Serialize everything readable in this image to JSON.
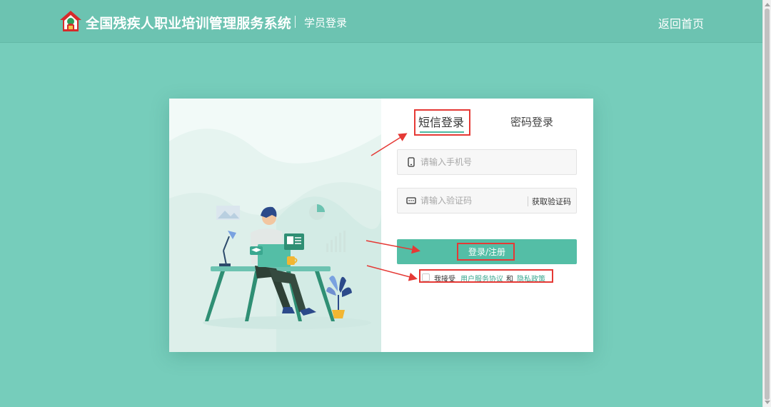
{
  "header": {
    "app_title": "全国残疾人职业培训管理服务系统",
    "page_subtitle": "学员登录",
    "home_link": "返回首页"
  },
  "login": {
    "tabs": [
      {
        "label": "短信登录",
        "active": true
      },
      {
        "label": "密码登录",
        "active": false
      }
    ],
    "phone_placeholder": "请输入手机号",
    "code_placeholder": "请输入验证码",
    "get_code_label": "获取验证码",
    "submit_label": "登录/注册",
    "agree_prefix": "我接受",
    "user_agreement": "用户服务协议",
    "and_text": "和",
    "privacy_policy": "隐私政策",
    "agree_checked": false
  },
  "colors": {
    "page_background": "#76cdbb",
    "header_background": "#6cc3b1",
    "accent": "#54bea6",
    "link": "#3aa78f",
    "annotation": "#e53935"
  },
  "icons": {
    "logo": "house-emblem-logo",
    "phone_field": "mobile-phone-icon",
    "code_field": "keyboard-icon"
  }
}
